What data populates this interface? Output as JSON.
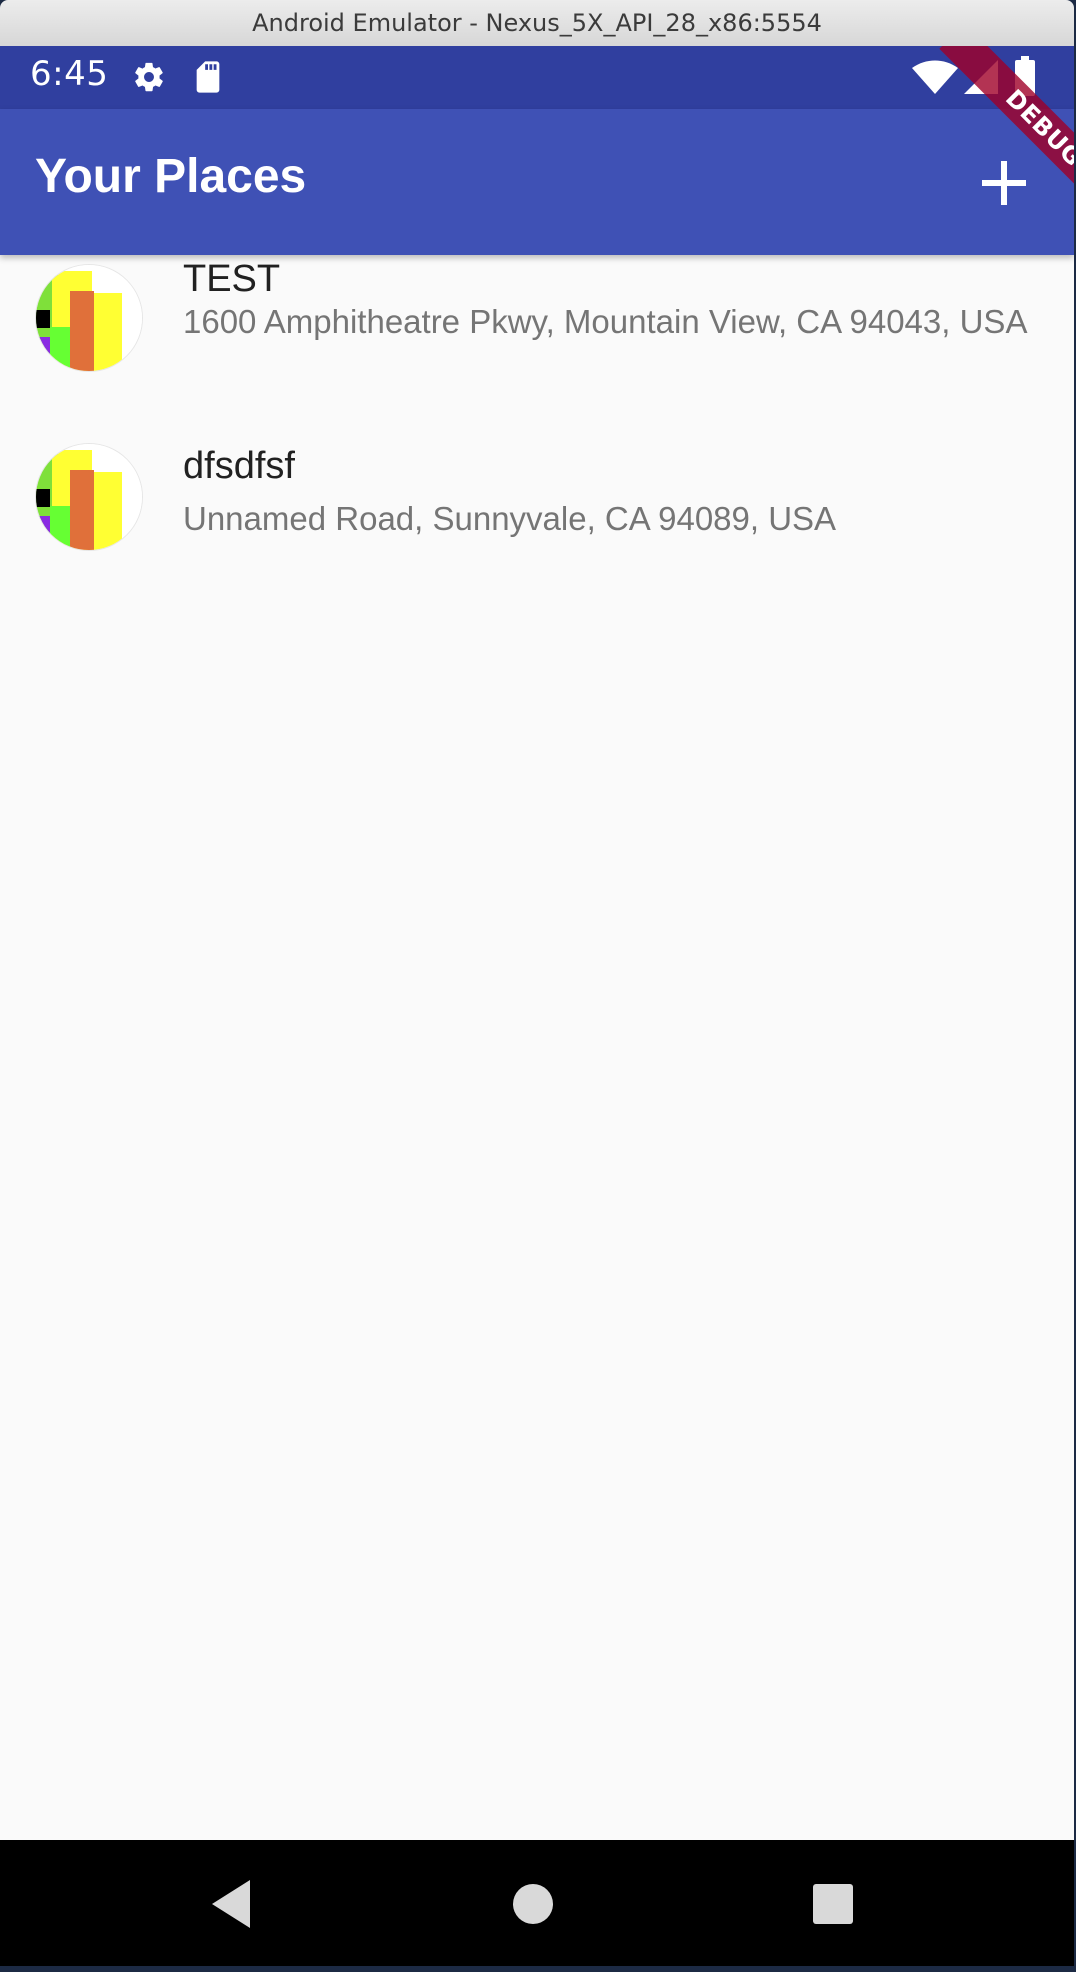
{
  "window": {
    "title": "Android Emulator - Nexus_5X_API_28_x86:5554"
  },
  "status_bar": {
    "time": "6:45",
    "icons": [
      "gear-icon",
      "sd-card-icon",
      "wifi-icon",
      "signal-icon",
      "battery-icon"
    ]
  },
  "app_bar": {
    "title": "Your Places",
    "action_icon": "add-icon"
  },
  "debug_banner": {
    "label": "DEBUG"
  },
  "places": [
    {
      "title": "TEST",
      "address": "1600 Amphitheatre Pkwy, Mountain View, CA 94043, USA"
    },
    {
      "title": "dfsdfsf",
      "address": "Unnamed Road, Sunnyvale, CA 94089, USA"
    }
  ],
  "nav_bar": {
    "icons": [
      "back-icon",
      "home-icon",
      "recents-icon"
    ]
  },
  "colors": {
    "status_bar": "#303f9f",
    "app_bar": "#3f51b5",
    "background": "#fafafa",
    "title_text": "#212121",
    "subtitle_text": "#757575"
  }
}
